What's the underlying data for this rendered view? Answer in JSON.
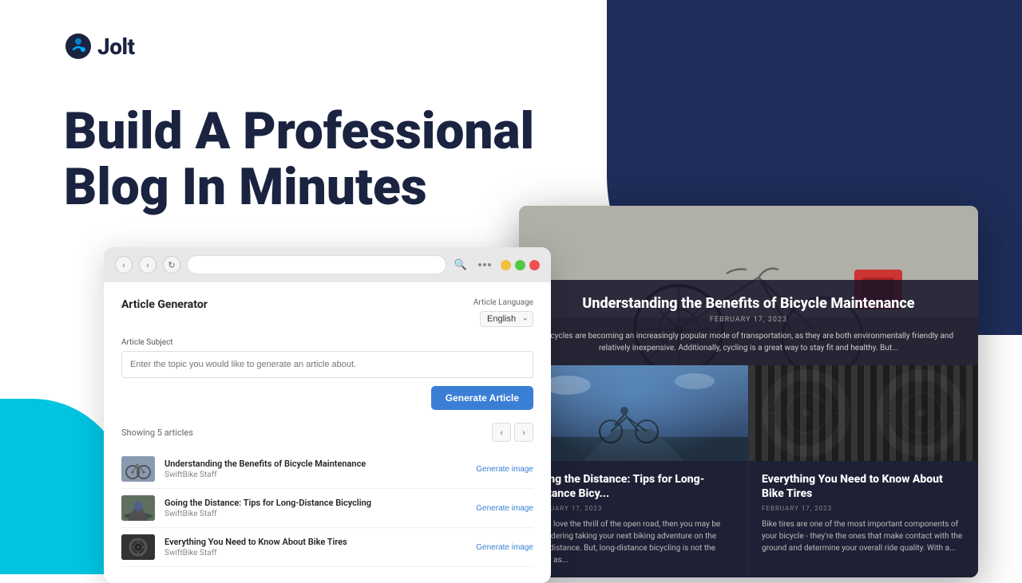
{
  "brand": {
    "name": "Jolt",
    "logo_symbol": "⚡"
  },
  "hero": {
    "headline_line1": "Build A Professional",
    "headline_line2": "Blog In Minutes"
  },
  "left_browser": {
    "address_bar_placeholder": "",
    "panel_title": "Article Generator",
    "language_label": "Article Language",
    "language_value": "English",
    "subject_label": "Article Subject",
    "subject_placeholder": "Enter the topic you would like to generate an article about.",
    "generate_btn": "Generate Article",
    "articles_count": "Showing 5 articles",
    "pagination_prev": "‹",
    "pagination_next": "›",
    "articles": [
      {
        "title": "Understanding the Benefits of Bicycle Maintenance",
        "author": "SwiftBike Staff",
        "action": "Generate image"
      },
      {
        "title": "Going the Distance: Tips for Long-Distance Bicycling",
        "author": "SwiftBike Staff",
        "action": "Generate image"
      },
      {
        "title": "Everything You Need to Know About Bike Tires",
        "author": "SwiftBike Staff",
        "action": "Generate image"
      }
    ]
  },
  "right_browser": {
    "hero_article": {
      "title": "Understanding the Benefits of Bicycle Maintenance",
      "date": "February 17, 2023",
      "excerpt": "Bicycles are becoming an increasingly popular mode of transportation, as they are both environmentally friendly and relatively inexpensive. Additionally, cycling is a great way to stay fit and healthy. But..."
    },
    "card1": {
      "title": "Going the Distance: Tips for Long-Distance Bicy...",
      "date": "February 17, 2023",
      "excerpt": "If you love the thrill of the open road, then you may be considering taking your next biking adventure on the long-distance. But, long-distance bicycling is not the same as..."
    },
    "card2": {
      "title": "Everything You Need to Know About Bike Tires",
      "date": "February 17, 2023",
      "excerpt": "Bike tires are one of the most important components of your bicycle - they're the ones that make contact with the ground and determine your overall ride quality. With a..."
    }
  },
  "colors": {
    "dark_navy": "#1e2d5a",
    "cyan_accent": "#00c4e0",
    "blue_btn": "#3a7fd5",
    "white": "#ffffff",
    "text_dark": "#1a2340"
  }
}
